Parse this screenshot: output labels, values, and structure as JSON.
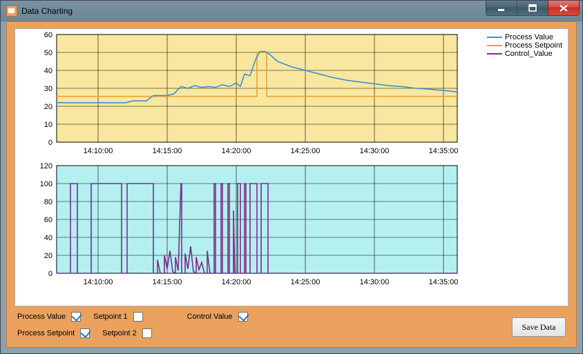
{
  "window": {
    "title": "Data Charting"
  },
  "winbuttons": {
    "min": "minimize",
    "max": "maximize",
    "close": "close"
  },
  "legend": {
    "pv": {
      "label": "Process Value",
      "color": "#3d8fd8"
    },
    "sp": {
      "label": "Process Setpoint",
      "color": "#e7a337"
    },
    "cv": {
      "label": "Control_Value",
      "color": "#7d2b8e"
    }
  },
  "checkboxes": {
    "process_value": {
      "label": "Process Value",
      "checked": true
    },
    "process_setpoint": {
      "label": "Process Setpoint",
      "checked": true
    },
    "setpoint1": {
      "label": "Setpoint 1",
      "checked": false
    },
    "setpoint2": {
      "label": "Setpoint 2",
      "checked": false
    },
    "control_value": {
      "label": "Control Value",
      "checked": true
    }
  },
  "buttons": {
    "save": "Save Data"
  },
  "chart_data": [
    {
      "type": "line",
      "title": "",
      "xlabel": "",
      "ylabel": "",
      "ylim": [
        0,
        60
      ],
      "yticks": [
        0,
        10,
        20,
        30,
        40,
        50,
        60
      ],
      "x_ticks_minutes": [
        970,
        975,
        980,
        985,
        990,
        995
      ],
      "x_tick_labels": [
        "14:10:00",
        "14:15:00",
        "14:20:00",
        "14:25:00",
        "14:30:00",
        "14:35:00"
      ],
      "series": [
        {
          "name": "Process Setpoint",
          "color": "#e7a337",
          "points": [
            [
              967,
              25.5
            ],
            [
              981.5,
              25.5
            ],
            [
              981.5,
              50
            ],
            [
              982.2,
              50
            ],
            [
              982.2,
              25.5
            ],
            [
              996,
              25.5
            ]
          ]
        },
        {
          "name": "Process Value",
          "color": "#3d8fd8",
          "points": [
            [
              967,
              22
            ],
            [
              972,
              22
            ],
            [
              972.5,
              23
            ],
            [
              973.5,
              23
            ],
            [
              974,
              26
            ],
            [
              975,
              26
            ],
            [
              975.5,
              27
            ],
            [
              976,
              31
            ],
            [
              976.5,
              30
            ],
            [
              977,
              31.5
            ],
            [
              977.5,
              30.5
            ],
            [
              978,
              31
            ],
            [
              978.5,
              30.5
            ],
            [
              979,
              32
            ],
            [
              979.5,
              31
            ],
            [
              980,
              33
            ],
            [
              980.3,
              31
            ],
            [
              980.6,
              38
            ],
            [
              981,
              37
            ],
            [
              981.4,
              46
            ],
            [
              981.7,
              50.5
            ],
            [
              982.1,
              50.5
            ],
            [
              982.4,
              49
            ],
            [
              983,
              45
            ],
            [
              984,
              42
            ],
            [
              985,
              40
            ],
            [
              986,
              38
            ],
            [
              987,
              36
            ],
            [
              988,
              34.5
            ],
            [
              989,
              33.5
            ],
            [
              990,
              32.5
            ],
            [
              991,
              31.5
            ],
            [
              992,
              31
            ],
            [
              993,
              30
            ],
            [
              994,
              29.5
            ],
            [
              995,
              28.8
            ],
            [
              996,
              28
            ]
          ]
        }
      ]
    },
    {
      "type": "line",
      "title": "",
      "xlabel": "",
      "ylabel": "",
      "ylim": [
        0,
        120
      ],
      "yticks": [
        0,
        20,
        40,
        60,
        80,
        100,
        120
      ],
      "x_ticks_minutes": [
        970,
        975,
        980,
        985,
        990,
        995
      ],
      "x_tick_labels": [
        "14:10:00",
        "14:15:00",
        "14:20:00",
        "14:25:00",
        "14:30:00",
        "14:35:00"
      ],
      "series": [
        {
          "name": "Control_Value",
          "color": "#7d2b8e",
          "points": [
            [
              967,
              0
            ],
            [
              968.0,
              0
            ],
            [
              968.0,
              100
            ],
            [
              968.5,
              100
            ],
            [
              968.5,
              0
            ],
            [
              969.5,
              0
            ],
            [
              969.5,
              100
            ],
            [
              971.7,
              100
            ],
            [
              971.7,
              0
            ],
            [
              972.1,
              0
            ],
            [
              972.1,
              100
            ],
            [
              974.0,
              100
            ],
            [
              974.0,
              0
            ],
            [
              974.3,
              0
            ],
            [
              974.3,
              15
            ],
            [
              974.5,
              0
            ],
            [
              974.8,
              0
            ],
            [
              974.8,
              20
            ],
            [
              975.0,
              5
            ],
            [
              975.2,
              25
            ],
            [
              975.4,
              2
            ],
            [
              975.6,
              0
            ],
            [
              975.6,
              18
            ],
            [
              975.8,
              3
            ],
            [
              976.0,
              100
            ],
            [
              976.05,
              100
            ],
            [
              976.05,
              0
            ],
            [
              976.3,
              0
            ],
            [
              976.3,
              22
            ],
            [
              976.5,
              5
            ],
            [
              976.7,
              30
            ],
            [
              976.9,
              2
            ],
            [
              977.1,
              0
            ],
            [
              977.1,
              18
            ],
            [
              977.3,
              4
            ],
            [
              977.5,
              12
            ],
            [
              977.7,
              0
            ],
            [
              977.9,
              0
            ],
            [
              977.9,
              25
            ],
            [
              978.1,
              0
            ],
            [
              978.4,
              0
            ],
            [
              978.4,
              100
            ],
            [
              978.5,
              100
            ],
            [
              978.5,
              0
            ],
            [
              978.9,
              0
            ],
            [
              978.9,
              100
            ],
            [
              979.0,
              100
            ],
            [
              979.0,
              0
            ],
            [
              979.4,
              0
            ],
            [
              979.4,
              100
            ],
            [
              979.5,
              100
            ],
            [
              979.5,
              0
            ],
            [
              979.8,
              0
            ],
            [
              979.8,
              70
            ],
            [
              979.9,
              0
            ],
            [
              980.1,
              0
            ],
            [
              980.1,
              100
            ],
            [
              980.3,
              100
            ],
            [
              980.3,
              0
            ],
            [
              980.6,
              0
            ],
            [
              980.6,
              100
            ],
            [
              980.7,
              100
            ],
            [
              980.7,
              0
            ],
            [
              981.0,
              0
            ],
            [
              981.0,
              100
            ],
            [
              981.5,
              100
            ],
            [
              981.5,
              0
            ],
            [
              981.8,
              0
            ],
            [
              981.8,
              100
            ],
            [
              982.3,
              100
            ],
            [
              982.3,
              0
            ],
            [
              996,
              0
            ]
          ]
        }
      ]
    }
  ]
}
